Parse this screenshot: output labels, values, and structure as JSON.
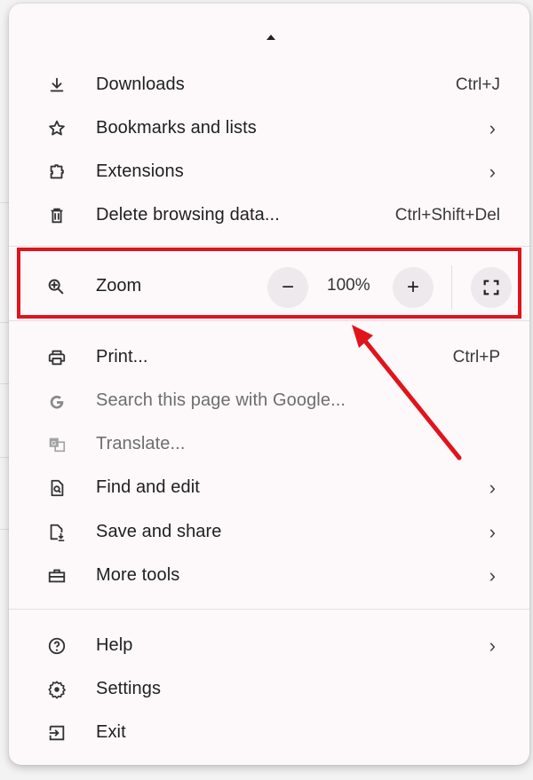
{
  "menu": {
    "groups": [
      {
        "items": [
          {
            "icon": "download-icon",
            "label": "Downloads",
            "shortcut": "Ctrl+J"
          },
          {
            "icon": "star-icon",
            "label": "Bookmarks and lists",
            "submenu": true
          },
          {
            "icon": "puzzle-icon",
            "label": "Extensions",
            "submenu": true
          },
          {
            "icon": "trash-icon",
            "label": "Delete browsing data...",
            "shortcut": "Ctrl+Shift+Del"
          }
        ]
      },
      {
        "zoom": {
          "icon": "zoom-in-icon",
          "label": "Zoom",
          "decrease_label": "−",
          "value": "100%",
          "increase_label": "+",
          "fullscreen_icon": "fullscreen-icon"
        }
      },
      {
        "items": [
          {
            "icon": "printer-icon",
            "label": "Print...",
            "shortcut": "Ctrl+P"
          },
          {
            "icon": "google-g-icon",
            "label": "Search this page with Google...",
            "disabled": true
          },
          {
            "icon": "translate-icon",
            "label": "Translate...",
            "disabled": true
          },
          {
            "icon": "find-in-page-icon",
            "label": "Find and edit",
            "submenu": true
          },
          {
            "icon": "save-file-icon",
            "label": "Save and share",
            "submenu": true
          },
          {
            "icon": "toolbox-icon",
            "label": "More tools",
            "submenu": true
          }
        ]
      },
      {
        "items": [
          {
            "icon": "help-icon",
            "label": "Help",
            "submenu": true
          },
          {
            "icon": "gear-icon",
            "label": "Settings"
          },
          {
            "icon": "exit-icon",
            "label": "Exit"
          }
        ]
      }
    ],
    "chevron_glyph": "›"
  },
  "annotation": {
    "highlight_color": "#e0141b",
    "target": "Zoom"
  }
}
